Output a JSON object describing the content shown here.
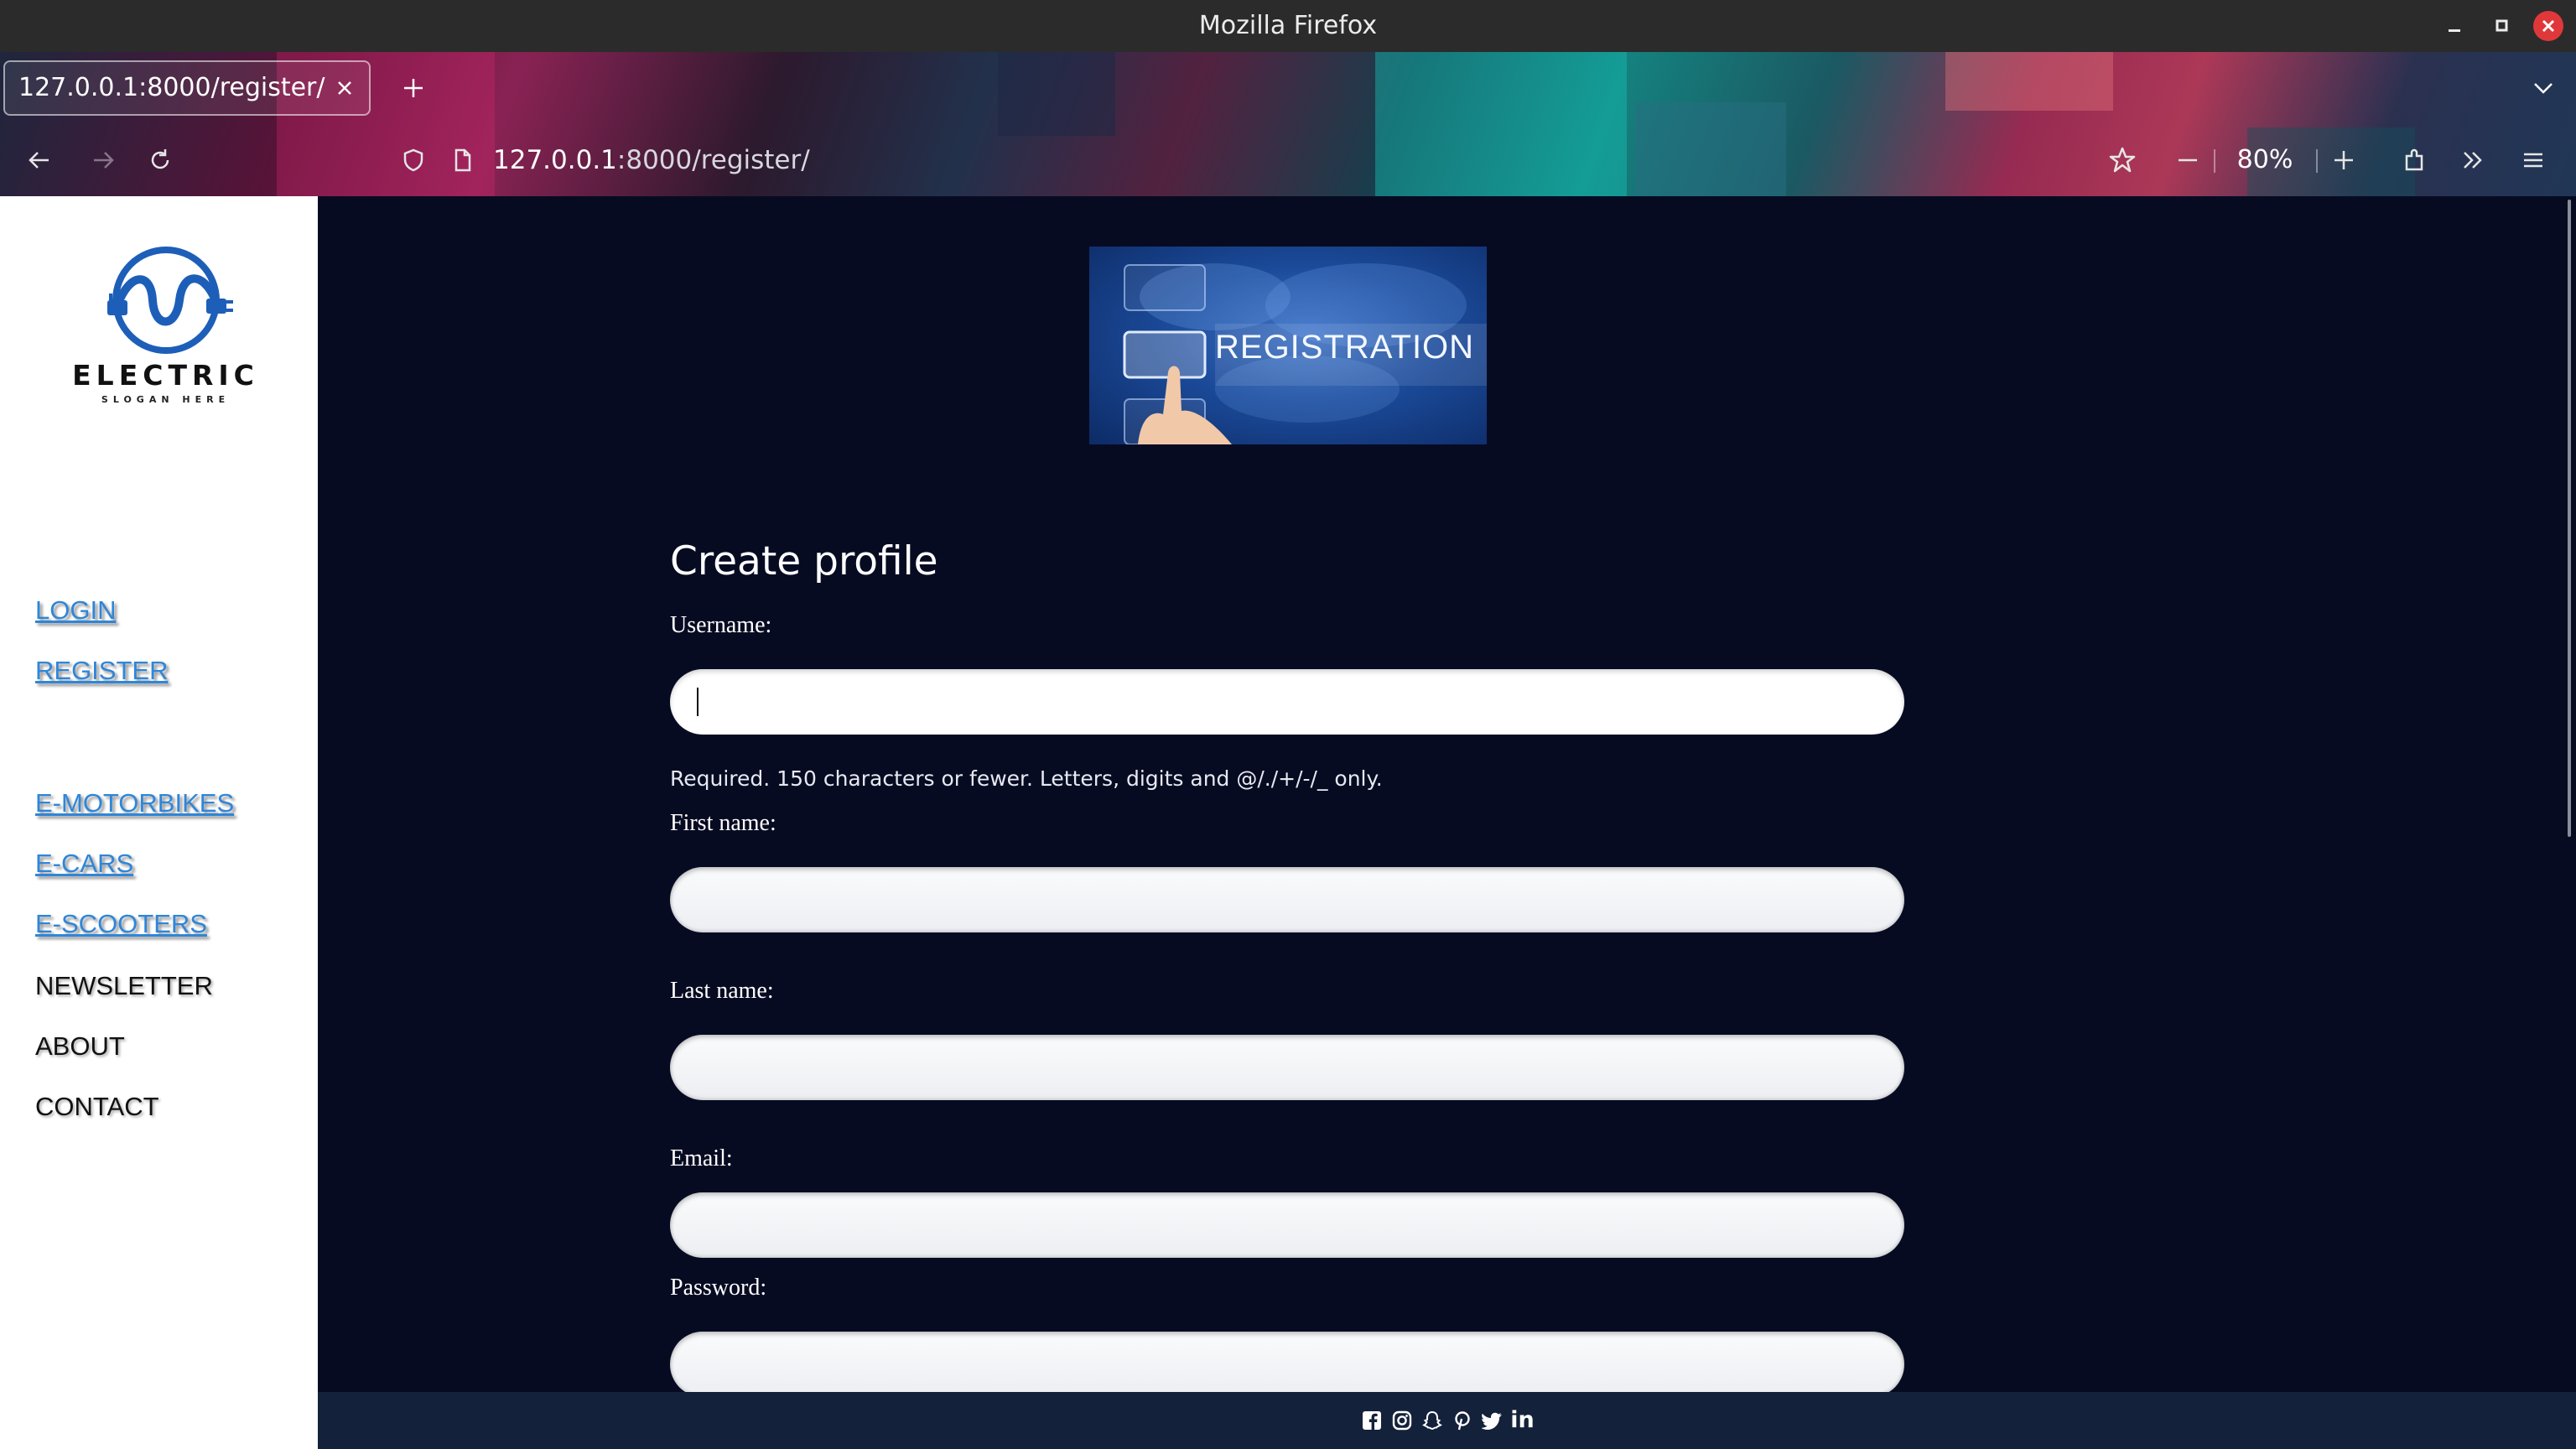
{
  "window": {
    "title": "Mozilla Firefox"
  },
  "browser": {
    "tab_title": "127.0.0.1:8000/register/",
    "url_host": "127.0.0.1",
    "url_rest": ":8000/register/",
    "zoom": "80%"
  },
  "sidebar": {
    "logo_word": "ELECTRIC",
    "logo_slogan": "SLOGAN HERE",
    "links": [
      {
        "label": "LOGIN"
      },
      {
        "label": "REGISTER"
      },
      {
        "label": "E-MOTORBIKES"
      },
      {
        "label": "E-CARS"
      },
      {
        "label": "E-SCOOTERS"
      },
      {
        "label": "NEWSLETTER"
      },
      {
        "label": "ABOUT"
      },
      {
        "label": "CONTACT"
      }
    ]
  },
  "banner": {
    "text": "REGISTRATION"
  },
  "form": {
    "title": "Create profile",
    "username_label": "Username:",
    "username_help": "Required. 150 characters or fewer. Letters, digits and @/./+/-/_ only.",
    "first_name_label": "First name:",
    "last_name_label": "Last name:",
    "email_label": "Email:",
    "password_label": "Password:",
    "username_value": "",
    "first_name_value": "",
    "last_name_value": "",
    "email_value": "",
    "password_value": ""
  },
  "footer": {
    "icons": [
      "facebook-icon",
      "instagram-icon",
      "snapchat-icon",
      "pinterest-icon",
      "twitter-icon",
      "linkedin-icon"
    ],
    "linkedin_text": "in"
  },
  "colors": {
    "page_bg": "#070b22",
    "sidebar_bg": "#ffffff",
    "link_blue": "#2f86d8",
    "footer_bg": "#14213a",
    "close_red": "#e0383a"
  }
}
